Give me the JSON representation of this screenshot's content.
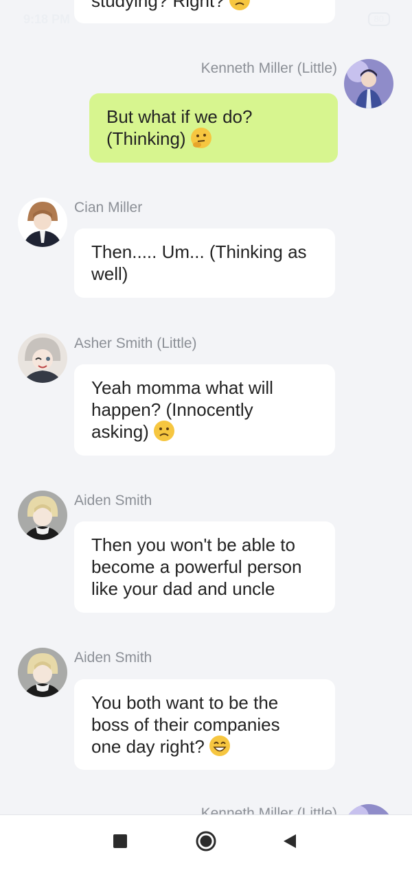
{
  "status_bar": {
    "time": "9:18 PM",
    "battery": "80"
  },
  "messages": [
    {
      "sender": "",
      "text": "studying? Right?",
      "emoji": "worried-face"
    },
    {
      "sender": "Kenneth Miller (Little)",
      "line1": "But what if we do?",
      "line2": "(Thinking)",
      "emoji": "thinking-face"
    },
    {
      "sender": "Cian Miller",
      "line1": "Then..... Um... (Thinking as",
      "line2": "well)"
    },
    {
      "sender": "Asher Smith (Little)",
      "line1": "Yeah momma what will",
      "line2": "happen? (Innocently",
      "line3": "asking)",
      "emoji": "slightly-frowning-face"
    },
    {
      "sender": "Aiden Smith",
      "line1": "Then you won't be able to",
      "line2": "become a powerful person",
      "line3": "like your dad and uncle"
    },
    {
      "sender": "Aiden Smith",
      "line1": "You both want to be the",
      "line2": "boss of their companies",
      "line3": "one day right?",
      "emoji": "grinning-face"
    },
    {
      "sender": "Kenneth Miller (Little)"
    }
  ],
  "nav": {
    "recent_icon": "square-icon",
    "home_icon": "circle-icon",
    "back_icon": "triangle-back-icon"
  },
  "colors": {
    "background": "#f3f4f7",
    "my_bubble": "#d7f58f",
    "other_bubble": "#ffffff",
    "sender_name": "#8b8f96"
  }
}
